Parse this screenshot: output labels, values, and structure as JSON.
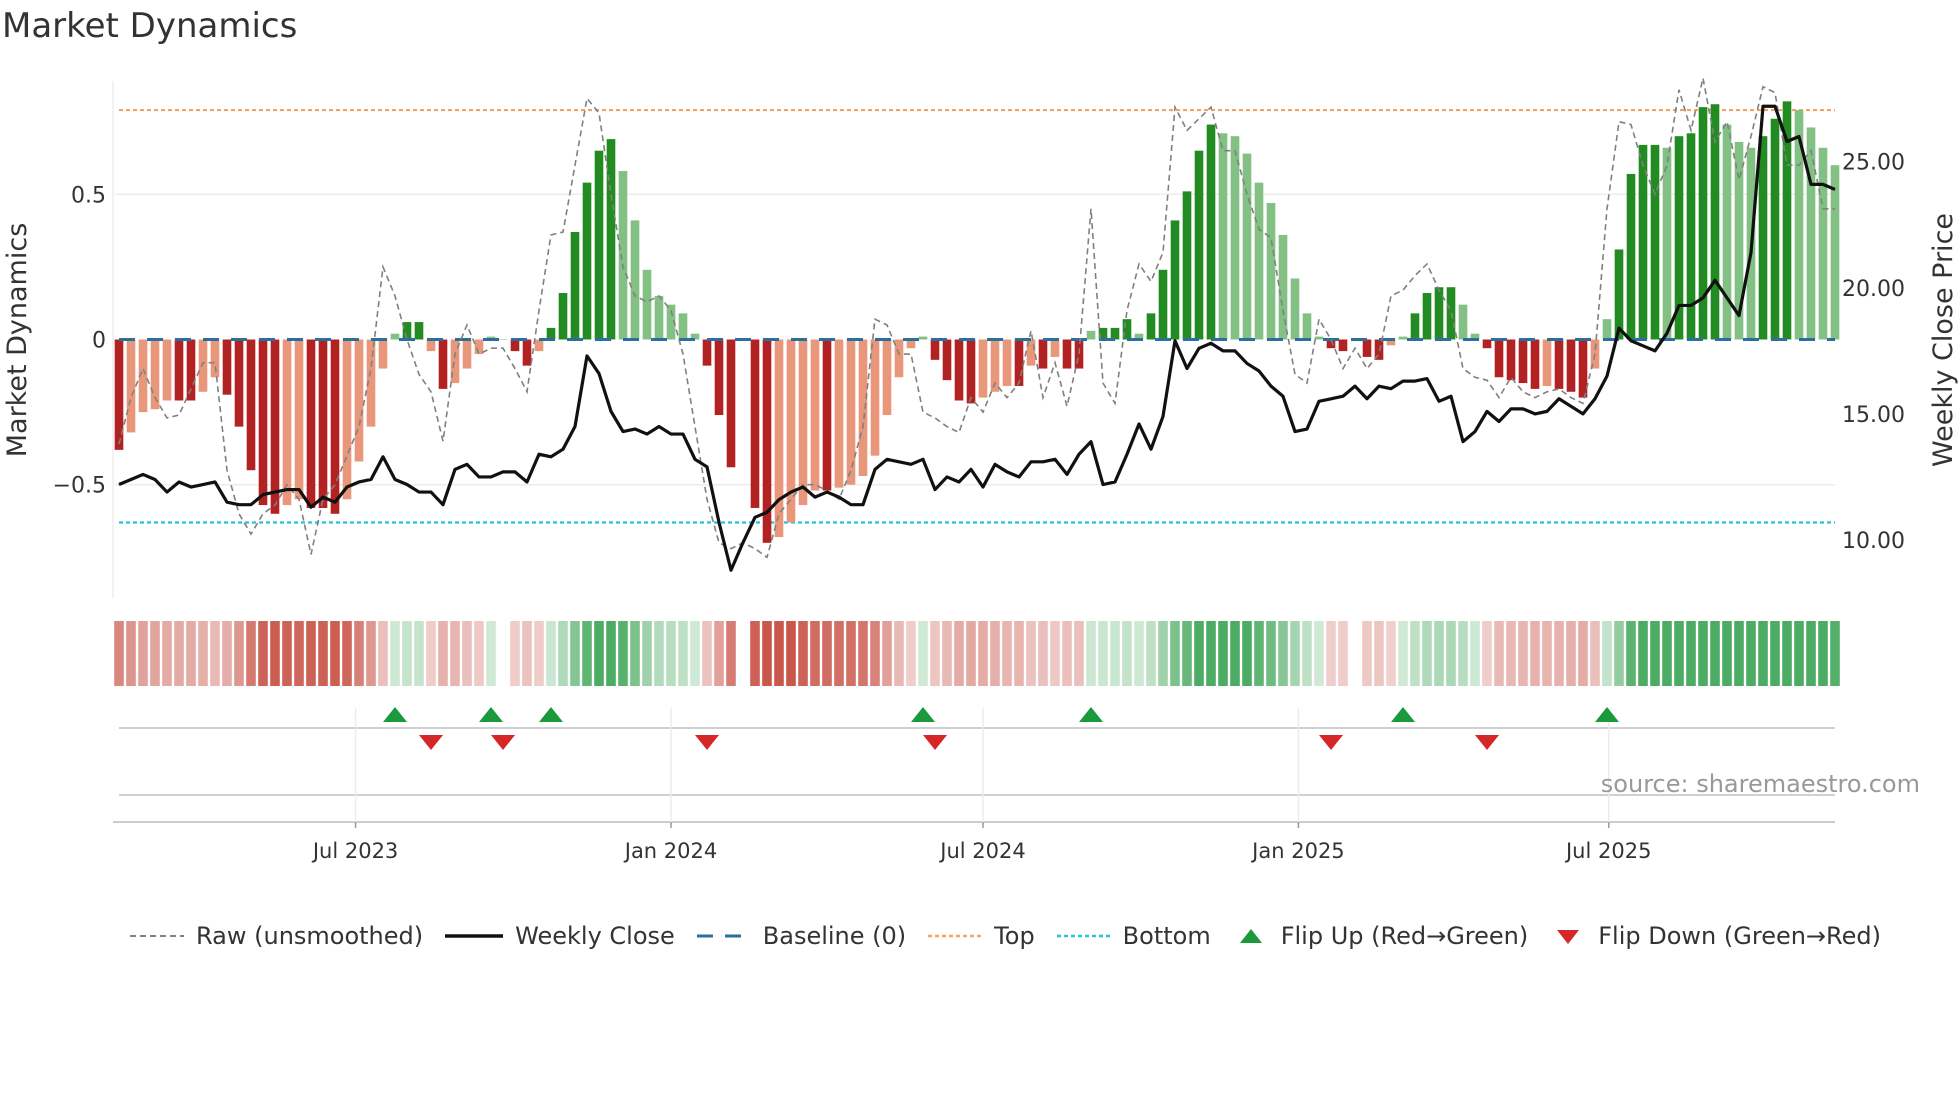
{
  "title": "Market Dynamics",
  "source": "source: sharemaestro.com",
  "colors": {
    "pos_strong": "#228b22",
    "pos_weak": "#82c083",
    "neg_strong": "#b22222",
    "neg_weak": "#e9977a",
    "strip_pos": "#2e9e48",
    "strip_neg": "#c0392b",
    "close": "#111111",
    "raw": "#808080",
    "baseline": "#2b6f9e",
    "top": "#f4a261",
    "bottom": "#22c5d8",
    "flip_up": "#1a9a3a",
    "flip_down": "#d62728"
  },
  "legend": [
    {
      "label": "Raw (unsmoothed)",
      "icon": "dashed-gray-line"
    },
    {
      "label": "Weekly Close",
      "icon": "solid-black-line"
    },
    {
      "label": "Baseline (0)",
      "icon": "dashed-blue-line"
    },
    {
      "label": "Top",
      "icon": "dotted-orange-line"
    },
    {
      "label": "Bottom",
      "icon": "dotted-cyan-line"
    },
    {
      "label": "Flip Up (Red→Green)",
      "icon": "triangle-up-green"
    },
    {
      "label": "Flip Down (Green→Red)",
      "icon": "triangle-down-red"
    }
  ],
  "chart_data": {
    "type": "bar",
    "title": "Market Dynamics",
    "ylabel": "Market Dynamics",
    "y2label": "Weekly Close Price",
    "ylim": [
      -0.89,
      0.89
    ],
    "y2lim": [
      7.7,
      28.2
    ],
    "yticks": [
      {
        "v": 0.5,
        "label": "0.5"
      },
      {
        "v": 0,
        "label": "0"
      },
      {
        "v": -0.5,
        "label": "−0.5"
      }
    ],
    "y2ticks": [
      {
        "v": 25,
        "label": "25.00"
      },
      {
        "v": 20,
        "label": "20.00"
      },
      {
        "v": 15,
        "label": "15.00"
      },
      {
        "v": 10,
        "label": "10.00"
      }
    ],
    "xticks": [
      {
        "date": "2023-07-01",
        "label": "Jul 2023"
      },
      {
        "date": "2024-01-01",
        "label": "Jan 2024"
      },
      {
        "date": "2024-07-01",
        "label": "Jul 2024"
      },
      {
        "date": "2025-01-01",
        "label": "Jan 2025"
      },
      {
        "date": "2025-07-01",
        "label": "Jul 2025"
      }
    ],
    "start_date": "2023-02-13",
    "interval_days": 7,
    "top_level": 0.79,
    "bottom_level": -0.63,
    "baseline": 0,
    "grid": true,
    "momentum": [
      -0.38,
      -0.32,
      -0.25,
      -0.24,
      -0.21,
      -0.21,
      -0.21,
      -0.18,
      -0.13,
      -0.19,
      -0.3,
      -0.45,
      -0.57,
      -0.6,
      -0.57,
      -0.55,
      -0.58,
      -0.58,
      -0.6,
      -0.55,
      -0.42,
      -0.3,
      -0.1,
      0.02,
      0.06,
      0.06,
      -0.04,
      -0.17,
      -0.15,
      -0.1,
      -0.05,
      0.01,
      0,
      -0.04,
      -0.09,
      -0.04,
      0.04,
      0.16,
      0.37,
      0.54,
      0.65,
      0.69,
      0.58,
      0.41,
      0.24,
      0.15,
      0.12,
      0.09,
      0.02,
      -0.09,
      -0.26,
      -0.44,
      0,
      -0.58,
      -0.7,
      -0.68,
      -0.63,
      -0.57,
      -0.52,
      -0.52,
      -0.51,
      -0.5,
      -0.47,
      -0.4,
      -0.26,
      -0.13,
      -0.03,
      0.01,
      -0.07,
      -0.14,
      -0.21,
      -0.22,
      -0.2,
      -0.18,
      -0.16,
      -0.16,
      -0.09,
      -0.1,
      -0.06,
      -0.1,
      -0.1,
      0.03,
      0.04,
      0.04,
      0.07,
      0.02,
      0.09,
      0.24,
      0.41,
      0.51,
      0.65,
      0.74,
      0.71,
      0.7,
      0.64,
      0.54,
      0.47,
      0.36,
      0.21,
      0.09,
      0.01,
      -0.03,
      -0.04,
      0,
      -0.06,
      -0.07,
      -0.02,
      0.01,
      0.09,
      0.16,
      0.18,
      0.18,
      0.12,
      0.02,
      -0.03,
      -0.13,
      -0.14,
      -0.15,
      -0.17,
      -0.16,
      -0.17,
      -0.18,
      -0.2,
      -0.1,
      0.07,
      0.31,
      0.57,
      0.67,
      0.67,
      0.66,
      0.7,
      0.71,
      0.8,
      0.81,
      0.74,
      0.68,
      0.66,
      0.7,
      0.76,
      0.82,
      0.79,
      0.73,
      0.66,
      0.6
    ],
    "raw": [
      -0.36,
      -0.2,
      -0.1,
      -0.2,
      -0.27,
      -0.26,
      -0.17,
      -0.08,
      -0.08,
      -0.45,
      -0.6,
      -0.67,
      -0.6,
      -0.57,
      -0.5,
      -0.55,
      -0.74,
      -0.55,
      -0.5,
      -0.4,
      -0.3,
      -0.1,
      0.25,
      0.15,
      0,
      -0.12,
      -0.18,
      -0.35,
      -0.05,
      0.05,
      -0.05,
      -0.03,
      -0.03,
      -0.1,
      -0.18,
      0.1,
      0.36,
      0.37,
      0.6,
      0.83,
      0.78,
      0.5,
      0.25,
      0.15,
      0.13,
      0.15,
      0.1,
      -0.05,
      -0.3,
      -0.55,
      -0.7,
      -0.72,
      -0.7,
      -0.72,
      -0.75,
      -0.6,
      -0.55,
      -0.5,
      -0.5,
      -0.52,
      -0.55,
      -0.45,
      -0.3,
      0.07,
      0.05,
      -0.05,
      -0.05,
      -0.25,
      -0.27,
      -0.3,
      -0.32,
      -0.2,
      -0.25,
      -0.15,
      -0.2,
      -0.15,
      0.03,
      -0.2,
      -0.08,
      -0.23,
      -0.05,
      0.45,
      -0.15,
      -0.22,
      0.1,
      0.26,
      0.2,
      0.3,
      0.8,
      0.72,
      0.76,
      0.8,
      0.65,
      0.65,
      0.5,
      0.38,
      0.35,
      0.1,
      -0.12,
      -0.15,
      0.07,
      0,
      -0.1,
      -0.03,
      -0.1,
      -0.05,
      0.15,
      0.17,
      0.22,
      0.26,
      0.17,
      0.1,
      -0.1,
      -0.13,
      -0.14,
      -0.2,
      -0.13,
      -0.18,
      -0.2,
      -0.18,
      -0.17,
      -0.2,
      -0.22,
      -0.05,
      0.45,
      0.75,
      0.74,
      0.6,
      0.5,
      0.6,
      0.86,
      0.72,
      0.9,
      0.68,
      0.75,
      0.55,
      0.7,
      0.87,
      0.85,
      0.6,
      0.6,
      0.65,
      0.45,
      0.45
    ],
    "close": [
      12.2,
      12.4,
      12.6,
      12.4,
      11.9,
      12.3,
      12.1,
      12.2,
      12.3,
      11.5,
      11.4,
      11.4,
      11.8,
      11.9,
      12.0,
      12.0,
      11.3,
      11.7,
      11.5,
      12.1,
      12.3,
      12.4,
      13.3,
      12.4,
      12.2,
      11.9,
      11.9,
      11.4,
      12.8,
      13.0,
      12.5,
      12.5,
      12.7,
      12.7,
      12.3,
      13.4,
      13.3,
      13.6,
      14.5,
      17.3,
      16.6,
      15.1,
      14.3,
      14.4,
      14.2,
      14.5,
      14.2,
      14.2,
      13.2,
      12.9,
      10.7,
      8.8,
      9.9,
      10.9,
      11.1,
      11.6,
      11.9,
      12.1,
      11.7,
      11.9,
      11.7,
      11.4,
      11.4,
      12.8,
      13.2,
      13.1,
      13.0,
      13.2,
      12.0,
      12.5,
      12.3,
      12.8,
      12.1,
      13.0,
      12.7,
      12.5,
      13.1,
      13.1,
      13.2,
      12.6,
      13.4,
      13.9,
      12.2,
      12.3,
      13.4,
      14.6,
      13.6,
      14.9,
      17.9,
      16.8,
      17.6,
      17.8,
      17.5,
      17.5,
      17.0,
      16.7,
      16.1,
      15.7,
      14.3,
      14.4,
      15.5,
      15.6,
      15.7,
      16.1,
      15.6,
      16.1,
      16.0,
      16.3,
      16.3,
      16.4,
      15.5,
      15.7,
      13.9,
      14.3,
      15.1,
      14.7,
      15.2,
      15.2,
      15.0,
      15.1,
      15.6,
      15.3,
      15.0,
      15.6,
      16.5,
      18.4,
      17.9,
      17.7,
      17.5,
      18.2,
      19.3,
      19.3,
      19.6,
      20.3,
      19.6,
      18.9,
      21.4,
      27.2,
      27.2,
      25.8,
      26.0,
      24.1,
      24.1,
      23.9
    ],
    "flips_up": [
      "2023-07-24",
      "2023-09-18",
      "2023-10-23",
      "2024-05-27",
      "2024-09-02",
      "2025-03-03",
      "2025-06-30"
    ],
    "flips_down": [
      "2023-08-14",
      "2023-09-25",
      "2024-01-22",
      "2024-06-03",
      "2025-01-20",
      "2025-04-21"
    ]
  }
}
